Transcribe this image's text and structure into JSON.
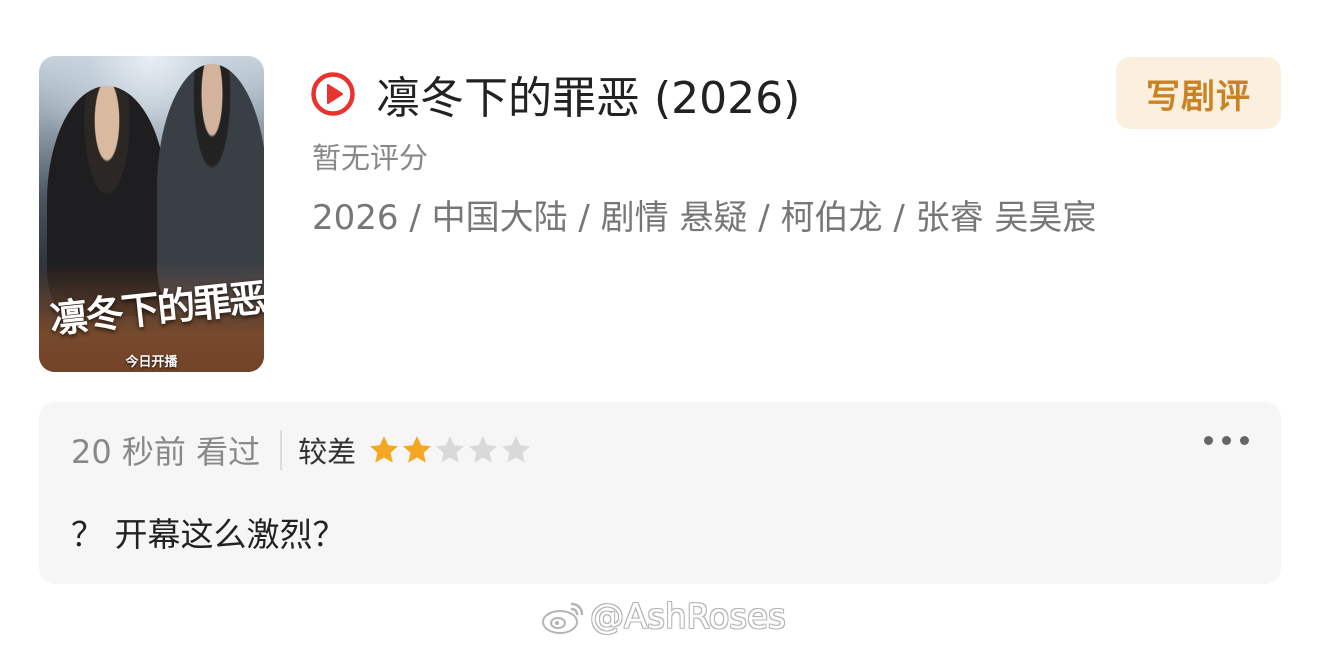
{
  "poster": {
    "calligraphy_title": "凛冬下的罪恶",
    "badge": "今日开播"
  },
  "show": {
    "title": "凛冬下的罪恶 (2026)",
    "rating_status": "暂无评分",
    "meta": "2026 / 中国大陆 / 剧情 悬疑 / 柯伯龙 / 张睿 吴昊宸"
  },
  "actions": {
    "write_review": "写剧评"
  },
  "review": {
    "time": "20 秒前 看过",
    "rating_label": "较差",
    "rating_value": 2,
    "rating_max": 5,
    "comment": "？ 开幕这么激烈？"
  },
  "watermark": {
    "text": "@AshRoses"
  },
  "colors": {
    "accent": "#e8332f",
    "star_filled": "#f5a623",
    "star_empty": "#d9d9d9",
    "button_bg": "#fbefdd",
    "button_text": "#c98325"
  },
  "icons": {
    "play": "play-circle-icon",
    "more": "more-dots-icon",
    "star": "star-icon",
    "weibo": "weibo-logo-icon"
  }
}
